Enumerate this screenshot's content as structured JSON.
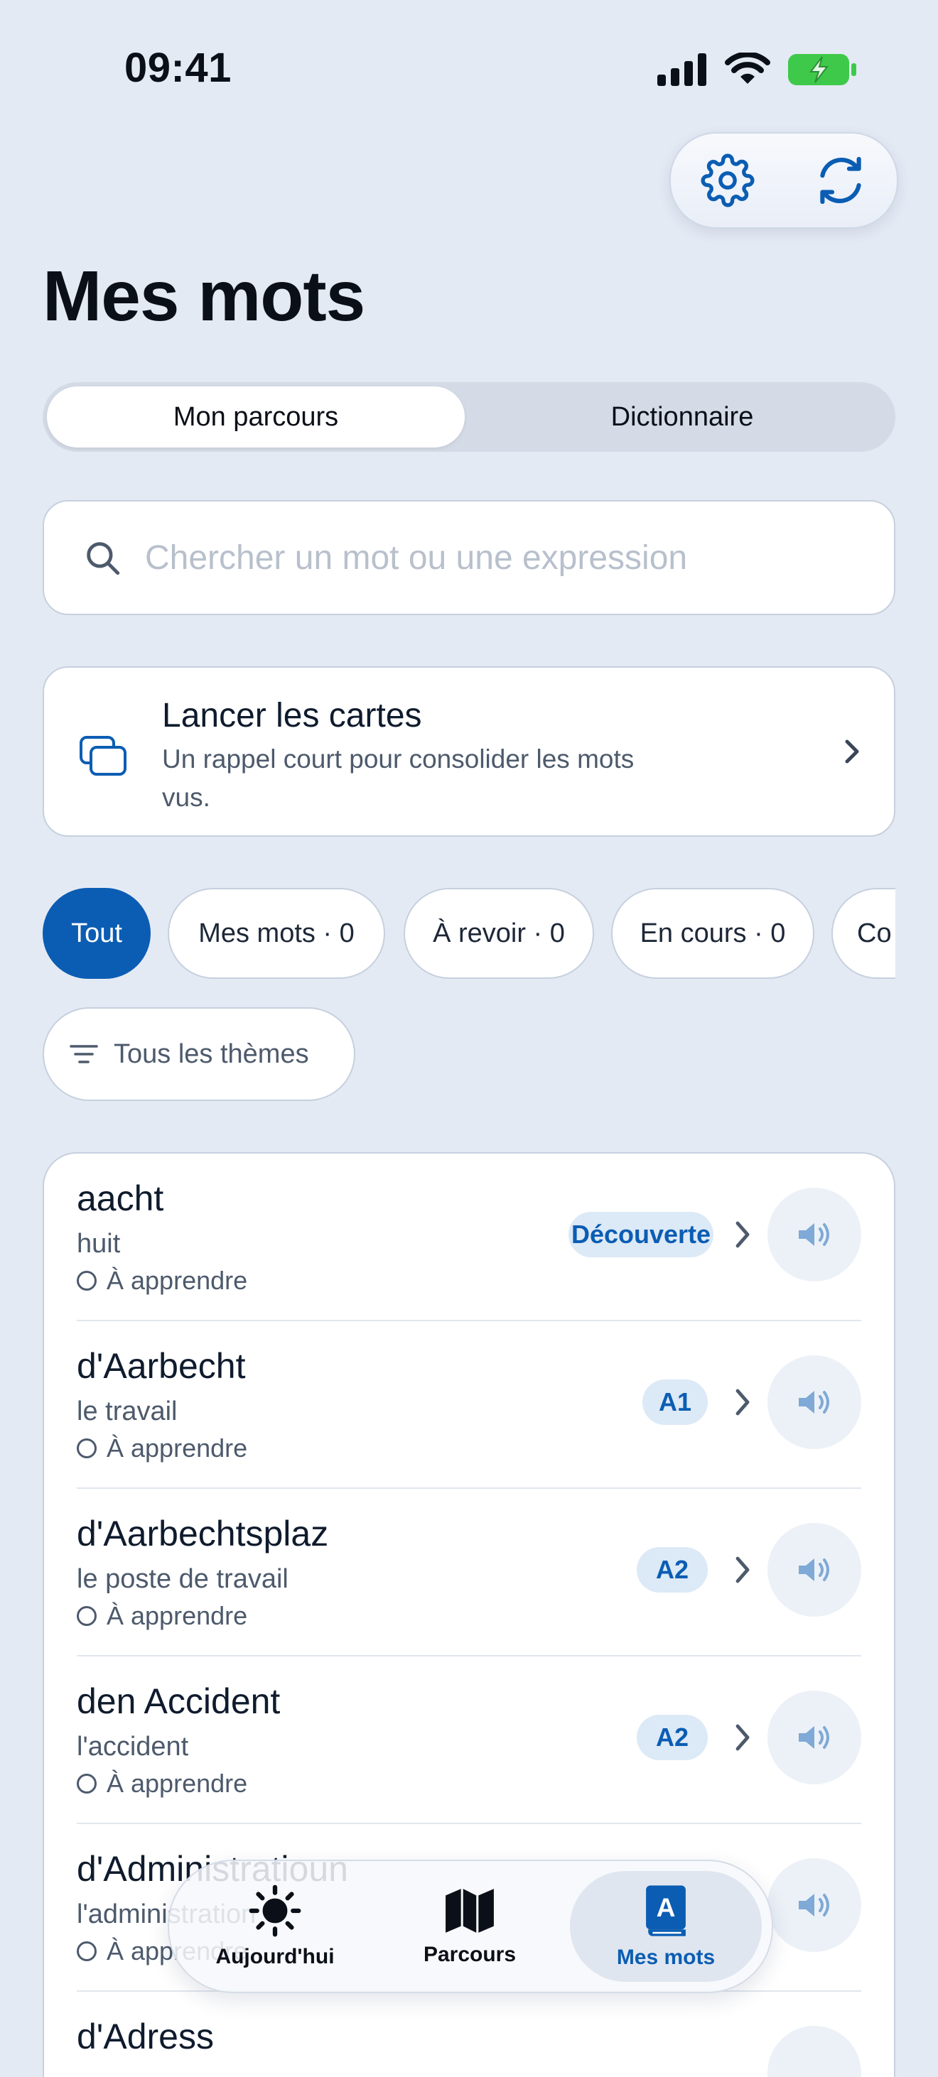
{
  "status_bar": {
    "time": "09:41"
  },
  "header": {
    "title": "Mes mots",
    "settings_icon": "gear-icon",
    "sync_icon": "refresh-icon"
  },
  "segmented": {
    "active_label": "Mon parcours",
    "inactive_label": "Dictionnaire"
  },
  "search": {
    "placeholder": "Chercher un mot ou une expression",
    "value": ""
  },
  "cards_card": {
    "title": "Lancer les cartes",
    "subtitle": "Un rappel court pour consolider les mots vus."
  },
  "filters": {
    "chips": [
      {
        "label": "Tout",
        "active": true
      },
      {
        "label": "Mes mots · 0",
        "active": false
      },
      {
        "label": "À revoir · 0",
        "active": false
      },
      {
        "label": "En cours · 0",
        "active": false
      },
      {
        "label": "Co",
        "active": false
      }
    ],
    "theme_label": "Tous les thèmes"
  },
  "words": [
    {
      "term": "aacht",
      "translation": "huit",
      "status": "À apprendre",
      "badge": "Découverte"
    },
    {
      "term": "d'Aarbecht",
      "translation": "le travail",
      "status": "À apprendre",
      "badge": "A1"
    },
    {
      "term": "d'Aarbechtsplaz",
      "translation": "le poste de travail",
      "status": "À apprendre",
      "badge": "A2"
    },
    {
      "term": "den Accident",
      "translation": "l'accident",
      "status": "À apprendre",
      "badge": "A2"
    },
    {
      "term": "d'Administratioun",
      "translation": "l'administration",
      "status": "À apprendre",
      "badge": ""
    },
    {
      "term": "d'Adress",
      "translation": "",
      "status": "",
      "badge": ""
    }
  ],
  "tab_bar": {
    "tabs": [
      {
        "label": "Aujourd'hui",
        "icon": "sun-icon",
        "active": false
      },
      {
        "label": "Parcours",
        "icon": "map-icon",
        "active": false
      },
      {
        "label": "Mes mots",
        "icon": "dictionary-icon",
        "active": true
      }
    ]
  },
  "colors": {
    "accent": "#0b5db3",
    "background": "#e4eaf4",
    "badge_bg": "#dce9f6"
  }
}
